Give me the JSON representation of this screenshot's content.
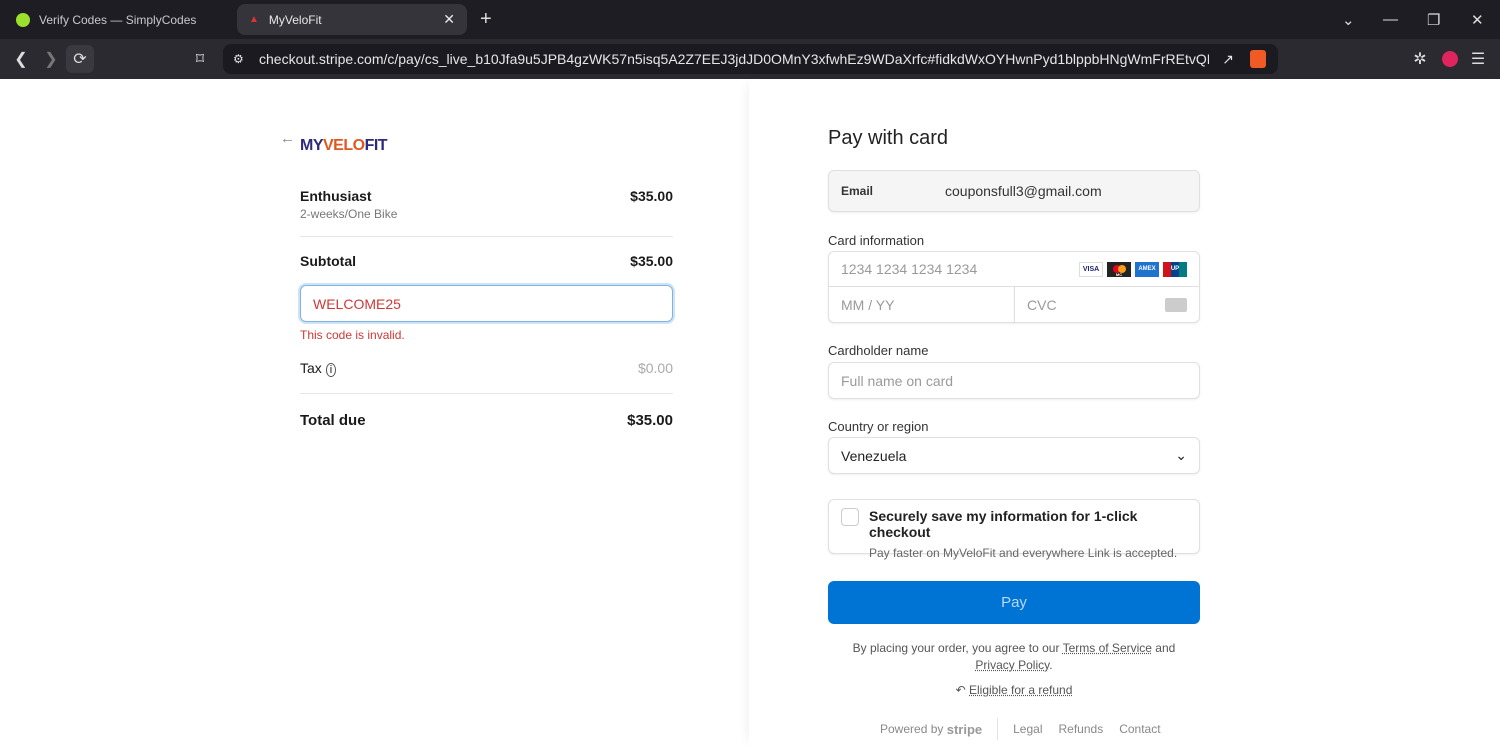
{
  "browser": {
    "tabs": [
      {
        "label": "Verify Codes — SimplyCodes"
      },
      {
        "label": "MyVeloFit"
      }
    ],
    "url": "checkout.stripe.com/c/pay/cs_live_b10Jfa9u5JPB4gzWK57n5isq5A2Z7EEJ3jdJD0OMnY3xfwhEz9WDaXrfc#fidkdWxOYHwnPyd1blppbHNgWmFrREtvQFBNMj..."
  },
  "order": {
    "brand": "MYVELOFIT",
    "item_name": "Enthusiast",
    "item_desc": "2-weeks/One Bike",
    "item_price": "$35.00",
    "subtotal_label": "Subtotal",
    "subtotal": "$35.00",
    "promo_code": "WELCOME25",
    "promo_error": "This code is invalid.",
    "tax_label": "Tax",
    "tax": "$0.00",
    "total_label": "Total due",
    "total": "$35.00"
  },
  "payment": {
    "title": "Pay with card",
    "email_label": "Email",
    "email": "couponsfull3@gmail.com",
    "card_label": "Card information",
    "card_placeholder": "1234 1234 1234 1234",
    "card_brands": [
      "VISA",
      "MC",
      "AMEX",
      "UP"
    ],
    "expiry_placeholder": "MM / YY",
    "cvc_placeholder": "CVC",
    "name_label": "Cardholder name",
    "name_placeholder": "Full name on card",
    "country_label": "Country or region",
    "country": "Venezuela",
    "save_title": "Securely save my information for 1-click checkout",
    "save_desc": "Pay faster on MyVeloFit and everywhere Link is accepted.",
    "pay_label": "Pay",
    "terms_prefix": "By placing your order, you agree to our",
    "terms_link": "Terms of Service",
    "terms_and": "and",
    "privacy_link": "Privacy Policy",
    "period": ".",
    "refund_link": "Eligible for a refund",
    "powered_by": "Powered by",
    "stripe": "stripe",
    "footer_links": [
      "Legal",
      "Refunds",
      "Contact"
    ],
    "accent": "#0074d4"
  }
}
